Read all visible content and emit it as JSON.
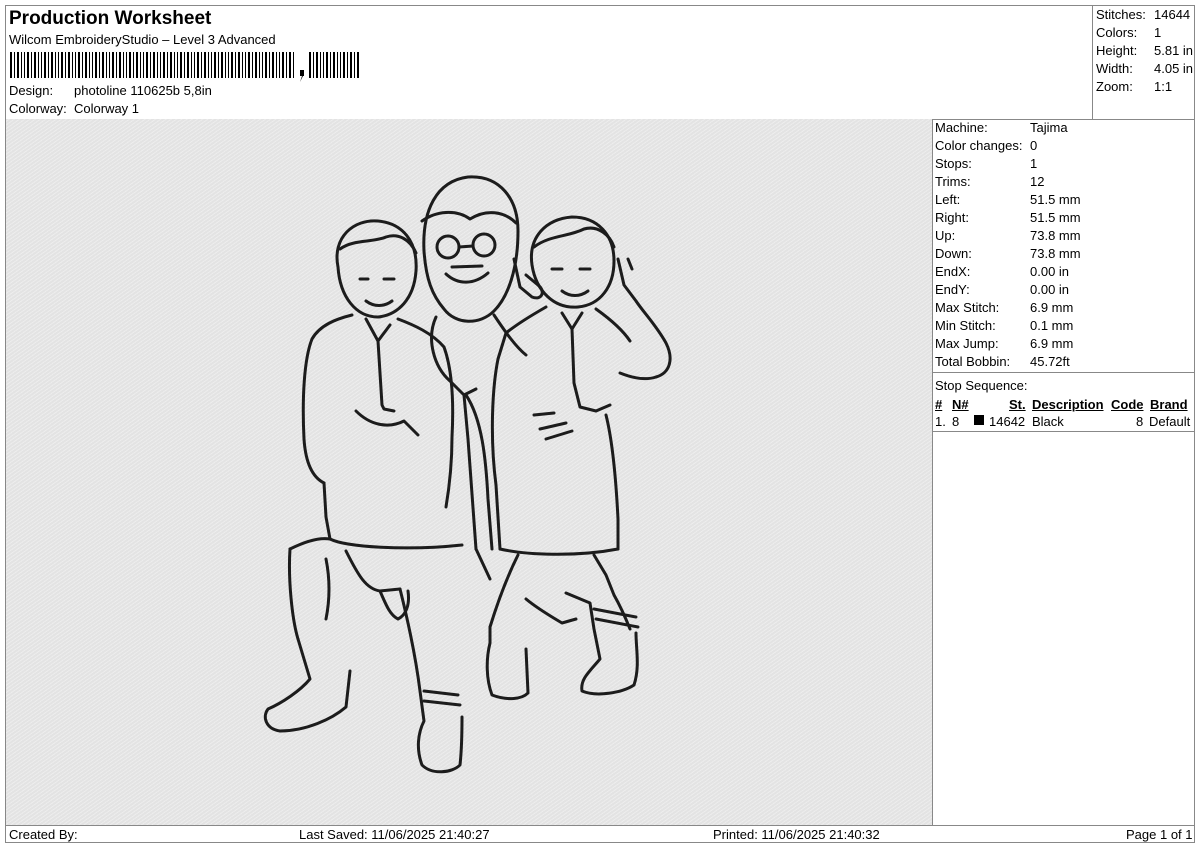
{
  "header": {
    "title": "Production Worksheet",
    "subtitle": "Wilcom EmbroideryStudio – Level 3 Advanced",
    "design_label": "Design:",
    "design_value": "photoline 110625b 5,8in",
    "colorway_label": "Colorway:",
    "colorway_value": "Colorway 1"
  },
  "top_stats": [
    {
      "label": "Stitches:",
      "value": "14644"
    },
    {
      "label": "Colors:",
      "value": "1"
    },
    {
      "label": "Height:",
      "value": "5.81 in"
    },
    {
      "label": "Width:",
      "value": "4.05 in"
    },
    {
      "label": "Zoom:",
      "value": "1:1"
    }
  ],
  "machine_stats": [
    {
      "label": "Machine:",
      "value": "Tajima"
    },
    {
      "label": "Color changes:",
      "value": "0"
    },
    {
      "label": "Stops:",
      "value": "1"
    },
    {
      "label": "Trims:",
      "value": "12"
    },
    {
      "label": "Left:",
      "value": "51.5 mm"
    },
    {
      "label": "Right:",
      "value": "51.5 mm"
    },
    {
      "label": "Up:",
      "value": "73.8 mm"
    },
    {
      "label": "Down:",
      "value": "73.8 mm"
    },
    {
      "label": "EndX:",
      "value": "0.00 in"
    },
    {
      "label": "EndY:",
      "value": "0.00 in"
    },
    {
      "label": "Max Stitch:",
      "value": "6.9 mm"
    },
    {
      "label": "Min Stitch:",
      "value": "0.1 mm"
    },
    {
      "label": "Max Jump:",
      "value": "6.9 mm"
    },
    {
      "label": "Total Bobbin:",
      "value": "45.72ft"
    }
  ],
  "stop_sequence": {
    "title": "Stop Sequence:",
    "headers": {
      "num": "#",
      "needle": "N#",
      "stitches": "St.",
      "description": "Description",
      "code": "Code",
      "brand": "Brand"
    },
    "rows": [
      {
        "num": "1.",
        "needle": "8",
        "swatch": "#000000",
        "stitches": "14642",
        "description": "Black",
        "code": "8",
        "brand": "Default"
      }
    ]
  },
  "footer": {
    "created_by": "Created By:",
    "last_saved": "Last Saved: 11/06/2025 21:40:27",
    "printed": "Printed: 11/06/2025 21:40:32",
    "page": "Page 1 of 1"
  }
}
